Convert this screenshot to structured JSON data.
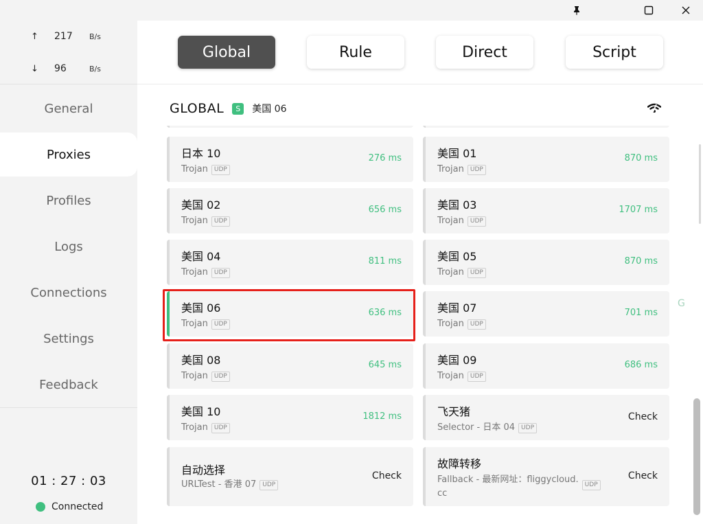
{
  "window": {
    "pin_icon": "pin-icon",
    "maximize_icon": "maximize-icon",
    "close_icon": "close-icon"
  },
  "traffic": {
    "up_arrow": "↑",
    "up_value": "217",
    "up_unit": "B/s",
    "down_arrow": "↓",
    "down_value": "96",
    "down_unit": "B/s"
  },
  "nav": {
    "general": "General",
    "proxies": "Proxies",
    "profiles": "Profiles",
    "logs": "Logs",
    "connections": "Connections",
    "settings": "Settings",
    "feedback": "Feedback"
  },
  "footer": {
    "time": "01 : 27 : 03",
    "status": "Connected"
  },
  "modes": {
    "global": "Global",
    "rule": "Rule",
    "direct": "Direct",
    "script": "Script",
    "active": "Global"
  },
  "group": {
    "name": "GLOBAL",
    "badge": "S",
    "current": "美国 06"
  },
  "proxies": [
    {
      "name": "日本 10",
      "type": "Trojan",
      "udp": "UDP",
      "delay": "276 ms"
    },
    {
      "name": "美国 01",
      "type": "Trojan",
      "udp": "UDP",
      "delay": "870 ms"
    },
    {
      "name": "美国 02",
      "type": "Trojan",
      "udp": "UDP",
      "delay": "656 ms"
    },
    {
      "name": "美国 03",
      "type": "Trojan",
      "udp": "UDP",
      "delay": "1707 ms"
    },
    {
      "name": "美国 04",
      "type": "Trojan",
      "udp": "UDP",
      "delay": "811 ms"
    },
    {
      "name": "美国 05",
      "type": "Trojan",
      "udp": "UDP",
      "delay": "870 ms"
    },
    {
      "name": "美国 06",
      "type": "Trojan",
      "udp": "UDP",
      "delay": "636 ms"
    },
    {
      "name": "美国 07",
      "type": "Trojan",
      "udp": "UDP",
      "delay": "701 ms"
    },
    {
      "name": "美国 08",
      "type": "Trojan",
      "udp": "UDP",
      "delay": "645 ms"
    },
    {
      "name": "美国 09",
      "type": "Trojan",
      "udp": "UDP",
      "delay": "686 ms"
    },
    {
      "name": "美国 10",
      "type": "Trojan",
      "udp": "UDP",
      "delay": "1812 ms"
    },
    {
      "name": "飞天猪",
      "type": "Selector - 日本 04",
      "udp": "UDP",
      "check": "Check"
    },
    {
      "name": "自动选择",
      "type": "URLTest - 香港 07",
      "udp": "UDP",
      "check": "Check"
    },
    {
      "name": "故障转移",
      "type_line1": "Fallback - 最新网址：fliggycloud.",
      "type_line2": "cc",
      "udp": "UDP",
      "check": "Check"
    }
  ],
  "edge_letter": "G",
  "colors": {
    "accent": "#3fbf7f",
    "active_mode_bg": "#505050",
    "highlight_box": "#e6201a"
  }
}
